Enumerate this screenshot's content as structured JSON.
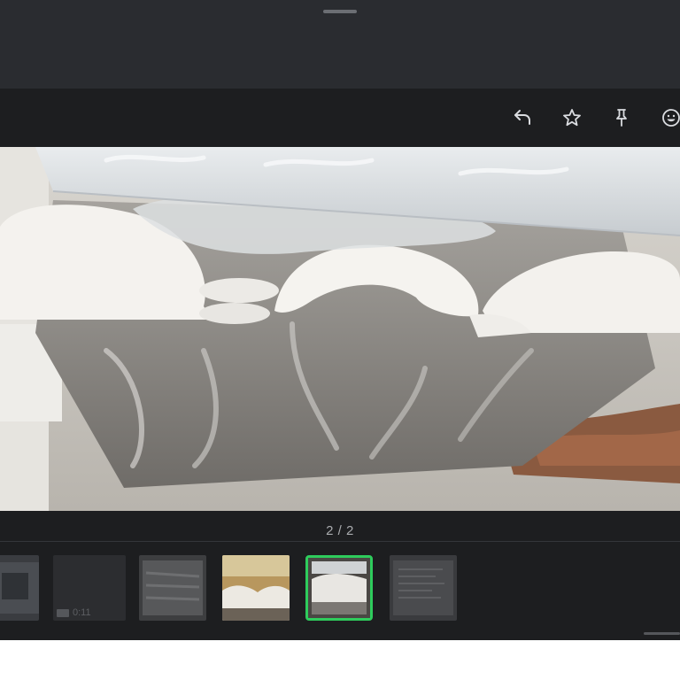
{
  "sheet": {
    "handle": "drag-handle"
  },
  "toolbar": {
    "actions": [
      {
        "name": "reply",
        "icon": "reply-icon"
      },
      {
        "name": "star",
        "icon": "star-icon"
      },
      {
        "name": "pin",
        "icon": "pin-icon"
      },
      {
        "name": "react",
        "icon": "emoji-icon"
      }
    ]
  },
  "viewer": {
    "counter": "2 / 2",
    "current_index": 2,
    "total": 2
  },
  "thumbnails": [
    {
      "id": "thumb-1",
      "kind": "image"
    },
    {
      "id": "thumb-2",
      "kind": "video",
      "duration": "0:11"
    },
    {
      "id": "thumb-3",
      "kind": "image"
    },
    {
      "id": "thumb-4",
      "kind": "image"
    },
    {
      "id": "thumb-5",
      "kind": "image",
      "selected": true
    },
    {
      "id": "thumb-6",
      "kind": "document"
    }
  ],
  "colors": {
    "selection": "#2ecc5c",
    "toolbar_icon": "#dadce0",
    "viewer_bg": "#1d1e20"
  }
}
